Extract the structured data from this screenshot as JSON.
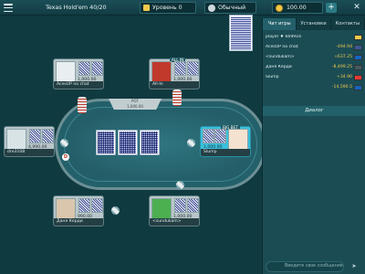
{
  "topbar": {
    "title": "Texas Hold'em  40/20",
    "level": "Уровень 0",
    "mode": "Обычный",
    "coins": "100.00",
    "plus": "+",
    "close": "✕"
  },
  "pot": {
    "label": "POT",
    "value": "1,000.00"
  },
  "seats": [
    {
      "id": "top-left",
      "chips": "1,000.00",
      "name": "AcesUP no chat",
      "flag_color": "#3b5998"
    },
    {
      "id": "top-right",
      "chips": "1,000.00",
      "name": "All-In",
      "tag": "ALL IN",
      "flag_color": "#4caf50"
    },
    {
      "id": "left",
      "chips": "4,990.00",
      "name": "dre3108",
      "flag_color": "#c0392b"
    },
    {
      "id": "right",
      "chips": "1,000.00",
      "name": "Slump",
      "tag": "BIG BET",
      "flag_color": "#1565c0"
    },
    {
      "id": "bottom-left",
      "chips": "990.00",
      "name": "Даня Керди",
      "flag_color": "#455a64"
    },
    {
      "id": "bottom-right",
      "chips": "1,000.00",
      "name": "<sundukam>",
      "flag_color": "#1565c0"
    }
  ],
  "panel": {
    "tabs": [
      "Чат игры",
      "Установки",
      "Контакты"
    ],
    "rows": [
      {
        "name": "player ♦ 669916",
        "value": "",
        "flag": "#f2c94c"
      },
      {
        "name": "AcesUP no chat",
        "value": "-494.94",
        "flag": "#3b5998"
      },
      {
        "name": "<sundukam>",
        "value": "+637.25",
        "flag": "#1565c0"
      },
      {
        "name": "Даня Керди",
        "value": "-8,499.25",
        "flag": "#455a64"
      },
      {
        "name": "Slump",
        "value": "+34.90",
        "flag": "#e53935"
      },
      {
        "name": "",
        "value": "-14,590.5",
        "flag": "#1565c0"
      }
    ],
    "dialog_label": "Диалог",
    "chat_placeholder": "Введите свое сообщение",
    "send": "➤"
  }
}
